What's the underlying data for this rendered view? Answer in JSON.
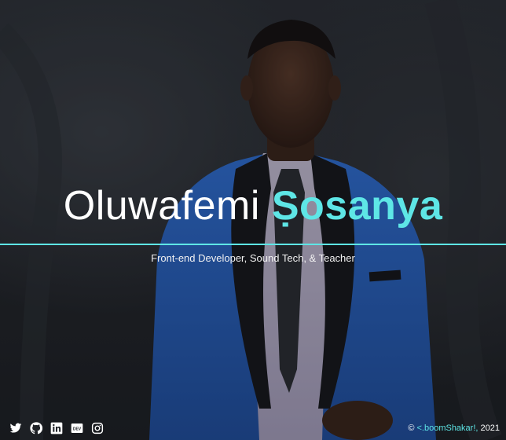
{
  "hero": {
    "first_name": "Oluwafemi",
    "last_name": "Ṣosanya",
    "tagline": "Front-end Developer, Sound Tech, & Teacher"
  },
  "social": [
    {
      "name": "twitter-icon"
    },
    {
      "name": "github-icon"
    },
    {
      "name": "linkedin-icon"
    },
    {
      "name": "dev-icon"
    },
    {
      "name": "instagram-icon"
    }
  ],
  "footer": {
    "copyright_symbol": "©",
    "brand": "<.boomShakar!,",
    "year": "2021"
  },
  "colors": {
    "accent": "#5ee6e6",
    "background": "#22252a",
    "jacket": "#2f6fd1",
    "text": "#ffffff"
  }
}
